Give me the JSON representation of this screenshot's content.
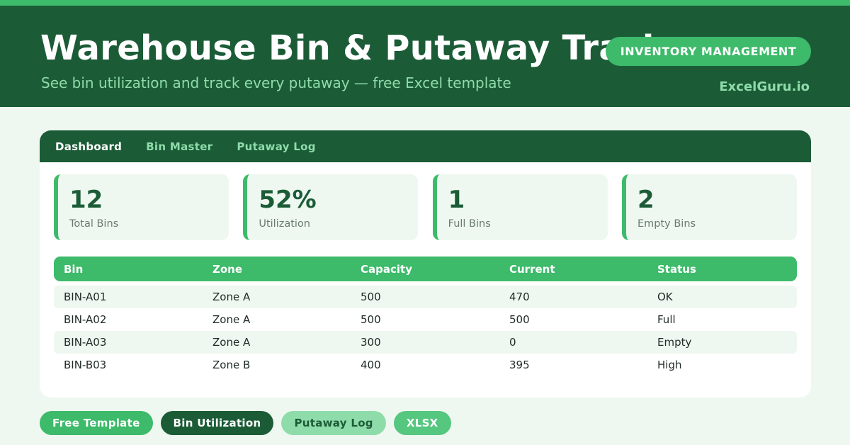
{
  "header": {
    "title": "Warehouse Bin & Putaway Tracker",
    "subtitle": "See bin utilization and track every putaway — free Excel template",
    "badge": "INVENTORY MANAGEMENT",
    "brand": "ExcelGuru.io"
  },
  "tabs": [
    {
      "label": "Dashboard",
      "active": true
    },
    {
      "label": "Bin Master",
      "active": false
    },
    {
      "label": "Putaway Log",
      "active": false
    }
  ],
  "kpis": [
    {
      "value": "12",
      "label": "Total Bins"
    },
    {
      "value": "52%",
      "label": "Utilization"
    },
    {
      "value": "1",
      "label": "Full Bins"
    },
    {
      "value": "2",
      "label": "Empty Bins"
    }
  ],
  "table": {
    "columns": [
      "Bin",
      "Zone",
      "Capacity",
      "Current",
      "Status"
    ],
    "rows": [
      [
        "BIN-A01",
        "Zone A",
        "500",
        "470",
        "OK"
      ],
      [
        "BIN-A02",
        "Zone A",
        "500",
        "500",
        "Full"
      ],
      [
        "BIN-A03",
        "Zone A",
        "300",
        "0",
        "Empty"
      ],
      [
        "BIN-B03",
        "Zone B",
        "400",
        "395",
        "High"
      ]
    ]
  },
  "chips": [
    {
      "label": "Free Template"
    },
    {
      "label": "Bin Utilization"
    },
    {
      "label": "Putaway Log"
    },
    {
      "label": "XLSX"
    }
  ],
  "colors": {
    "dark_green": "#1b5c37",
    "accent_green": "#3dba6a",
    "light_green": "#8fdcab",
    "background": "#eef8f0"
  }
}
